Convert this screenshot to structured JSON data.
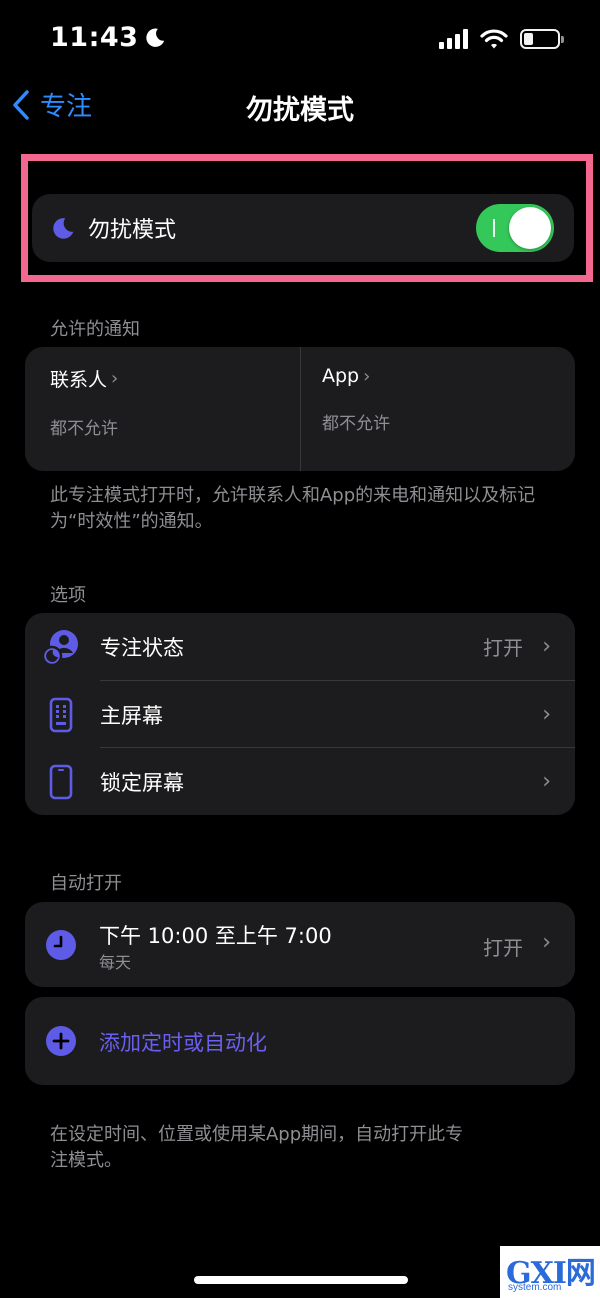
{
  "status": {
    "time": "11:43",
    "moon_icon": "moon-icon",
    "signal_icon": "cellular-signal-icon",
    "wifi_icon": "wifi-icon",
    "battery_icon": "battery-icon"
  },
  "nav": {
    "back_label": "专注",
    "title": "勿扰模式"
  },
  "focus_toggle": {
    "label": "勿扰模式",
    "icon": "moon-icon",
    "state": "on",
    "accent": "#5e5ce6",
    "on_color": "#34c759"
  },
  "allowed": {
    "section_title": "允许的通知",
    "people_title": "联系人",
    "people_value": "都不允许",
    "apps_title": "App",
    "apps_value": "都不允许",
    "note": "此专注模式打开时，允许联系人和App的来电和通知以及标记为“时效性”的通知。"
  },
  "options": {
    "section_title": "选项",
    "items": [
      {
        "label": "专注状态",
        "value": "打开",
        "icon": "focus-status-icon"
      },
      {
        "label": "主屏幕",
        "value": "",
        "icon": "home-screen-icon"
      },
      {
        "label": "锁定屏幕",
        "value": "",
        "icon": "lock-screen-icon"
      }
    ]
  },
  "auto": {
    "section_title": "自动打开",
    "schedule_time": "下午 10:00 至上午 7:00",
    "schedule_days": "每天",
    "schedule_value": "打开",
    "add_label": "添加定时或自动化",
    "note": "在设定时间、位置或使用某App期间，自动打开此专注模式。"
  },
  "watermark": {
    "logo": "GXI网",
    "url": "system.com"
  }
}
